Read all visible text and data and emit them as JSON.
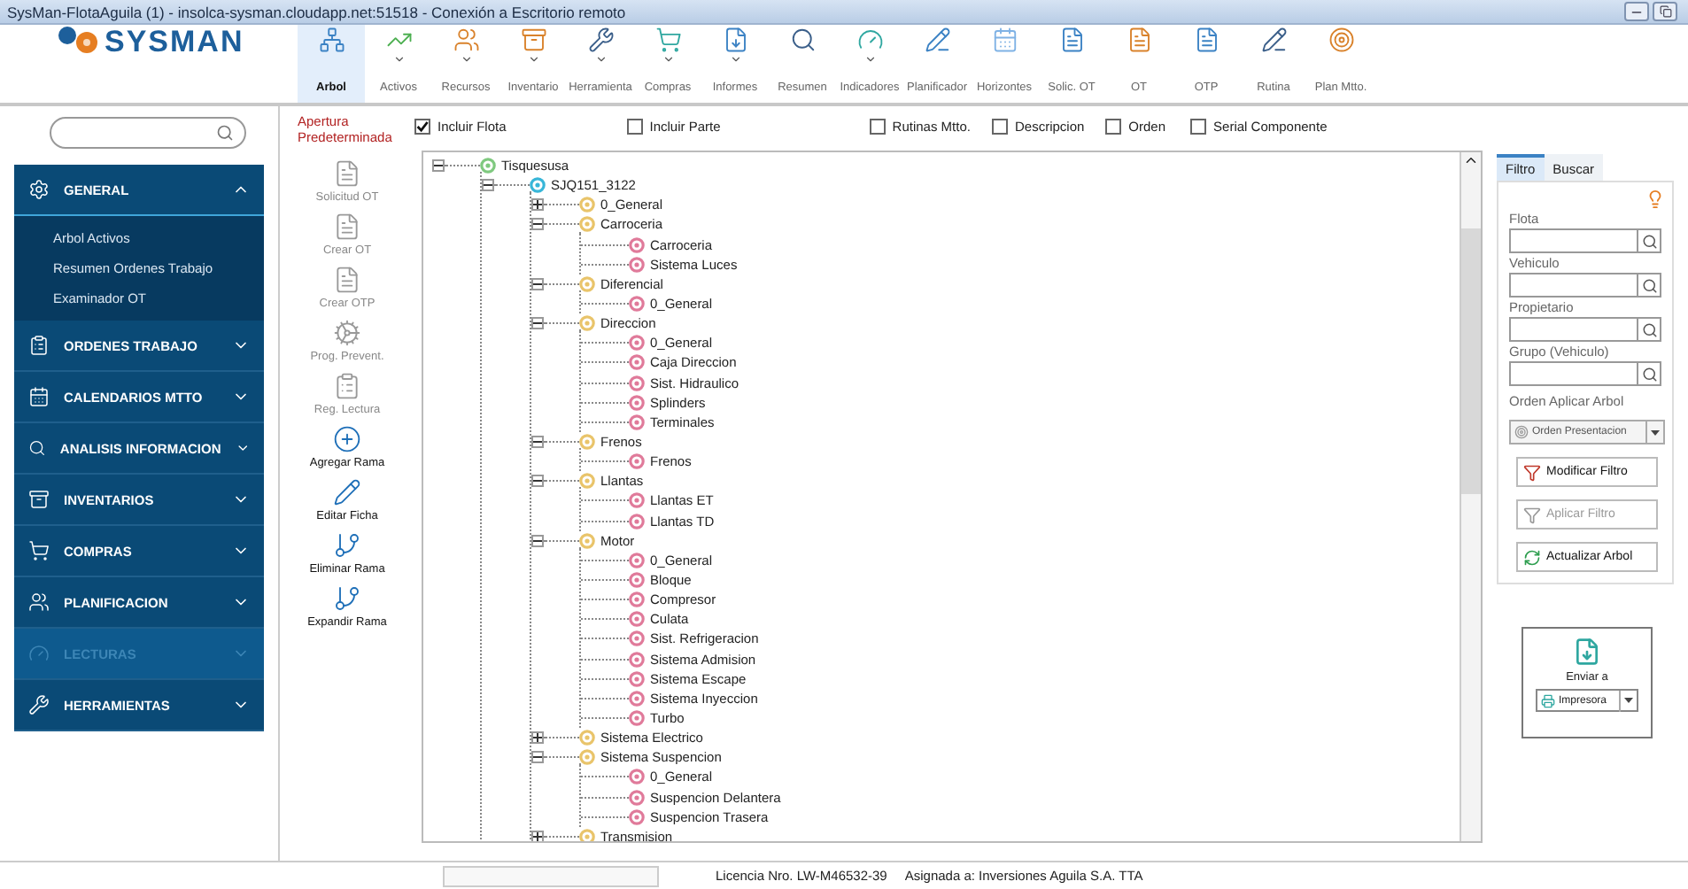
{
  "window": {
    "title": "SysMan-FlotaAguila (1) - insolca-sysman.cloudapp.net:51518 - Conexión a Escritorio remoto"
  },
  "logo": {
    "text": "SYSMAN"
  },
  "toolbar": {
    "items": [
      {
        "label": "Arbol",
        "selected": true,
        "has_menu": false
      },
      {
        "label": "Activos",
        "selected": false,
        "has_menu": true
      },
      {
        "label": "Recursos",
        "selected": false,
        "has_menu": true
      },
      {
        "label": "Inventario",
        "selected": false,
        "has_menu": true
      },
      {
        "label": "Herramienta",
        "selected": false,
        "has_menu": true
      },
      {
        "label": "Compras",
        "selected": false,
        "has_menu": true
      },
      {
        "label": "Informes",
        "selected": false,
        "has_menu": true
      },
      {
        "label": "Resumen",
        "selected": false,
        "has_menu": false
      },
      {
        "label": "Indicadores",
        "selected": false,
        "has_menu": true
      },
      {
        "label": "Planificador",
        "selected": false,
        "has_menu": false
      },
      {
        "label": "Horizontes",
        "selected": false,
        "has_menu": false
      },
      {
        "label": "Solic. OT",
        "selected": false,
        "has_menu": false
      },
      {
        "label": "OT",
        "selected": false,
        "has_menu": false
      },
      {
        "label": "OTP",
        "selected": false,
        "has_menu": false
      },
      {
        "label": "Rutina",
        "selected": false,
        "has_menu": false
      },
      {
        "label": "Plan Mtto.",
        "selected": false,
        "has_menu": false
      }
    ]
  },
  "sidebar": {
    "sections": [
      {
        "label": "GENERAL",
        "expanded": true,
        "disabled": false,
        "children": [
          "Arbol Activos",
          "Resumen Ordenes Trabajo",
          "Examinador OT"
        ]
      },
      {
        "label": "ORDENES TRABAJO",
        "expanded": false,
        "disabled": false
      },
      {
        "label": "CALENDARIOS MTTO",
        "expanded": false,
        "disabled": false
      },
      {
        "label": "ANALISIS INFORMACION",
        "expanded": false,
        "disabled": false
      },
      {
        "label": "INVENTARIOS",
        "expanded": false,
        "disabled": false
      },
      {
        "label": "COMPRAS",
        "expanded": false,
        "disabled": false
      },
      {
        "label": "PLANIFICACION",
        "expanded": false,
        "disabled": false
      },
      {
        "label": "LECTURAS",
        "expanded": false,
        "disabled": true
      },
      {
        "label": "HERRAMIENTAS",
        "expanded": false,
        "disabled": false
      }
    ]
  },
  "actions": {
    "heading": "Apertura Predeterminada",
    "items": [
      {
        "label": "Solicitud OT",
        "disabled": true
      },
      {
        "label": "Crear OT",
        "disabled": true
      },
      {
        "label": "Crear OTP",
        "disabled": true
      },
      {
        "label": "Prog. Prevent.",
        "disabled": true
      },
      {
        "label": "Reg. Lectura",
        "disabled": true
      },
      {
        "label": "Agregar Rama",
        "disabled": false
      },
      {
        "label": "Editar Ficha",
        "disabled": false
      },
      {
        "label": "Eliminar Rama",
        "disabled": false
      },
      {
        "label": "Expandir Rama",
        "disabled": false
      }
    ]
  },
  "filters": [
    {
      "label": "Incluir Flota",
      "checked": true
    },
    {
      "label": "Incluir Parte",
      "checked": false
    },
    {
      "label": "Rutinas Mtto.",
      "checked": false
    },
    {
      "label": "Descripcion",
      "checked": false
    },
    {
      "label": "Orden",
      "checked": false
    },
    {
      "label": "Serial Componente",
      "checked": false
    }
  ],
  "tree": [
    {
      "label": "Tisquesusa",
      "kind": "fleet",
      "expanded": true,
      "children": [
        {
          "label": "SJQ151_3122",
          "kind": "vehicle",
          "expanded": true,
          "children": [
            {
              "label": "0_General",
              "kind": "system",
              "expanded": false
            },
            {
              "label": "Carroceria",
              "kind": "system",
              "expanded": true,
              "children": [
                {
                  "label": "Carroceria",
                  "kind": "part"
                },
                {
                  "label": "Sistema Luces",
                  "kind": "part"
                }
              ]
            },
            {
              "label": "Diferencial",
              "kind": "system",
              "expanded": true,
              "children": [
                {
                  "label": "0_General",
                  "kind": "part"
                }
              ]
            },
            {
              "label": "Direccion",
              "kind": "system",
              "expanded": true,
              "children": [
                {
                  "label": "0_General",
                  "kind": "part"
                },
                {
                  "label": "Caja Direccion",
                  "kind": "part"
                },
                {
                  "label": "Sist. Hidraulico",
                  "kind": "part"
                },
                {
                  "label": "Splinders",
                  "kind": "part"
                },
                {
                  "label": "Terminales",
                  "kind": "part"
                }
              ]
            },
            {
              "label": "Frenos",
              "kind": "system",
              "expanded": true,
              "children": [
                {
                  "label": "Frenos",
                  "kind": "part"
                }
              ]
            },
            {
              "label": "Llantas",
              "kind": "system",
              "expanded": true,
              "children": [
                {
                  "label": "Llantas ET",
                  "kind": "part"
                },
                {
                  "label": "Llantas TD",
                  "kind": "part"
                }
              ]
            },
            {
              "label": "Motor",
              "kind": "system",
              "expanded": true,
              "children": [
                {
                  "label": "0_General",
                  "kind": "part"
                },
                {
                  "label": "Bloque",
                  "kind": "part"
                },
                {
                  "label": "Compresor",
                  "kind": "part"
                },
                {
                  "label": "Culata",
                  "kind": "part"
                },
                {
                  "label": "Sist. Refrigeracion",
                  "kind": "part"
                },
                {
                  "label": "Sistema Admision",
                  "kind": "part"
                },
                {
                  "label": "Sistema Escape",
                  "kind": "part"
                },
                {
                  "label": "Sistema Inyeccion",
                  "kind": "part"
                },
                {
                  "label": "Turbo",
                  "kind": "part"
                }
              ]
            },
            {
              "label": "Sistema Electrico",
              "kind": "system",
              "expanded": false
            },
            {
              "label": "Sistema Suspencion",
              "kind": "system",
              "expanded": true,
              "children": [
                {
                  "label": "0_General",
                  "kind": "part"
                },
                {
                  "label": "Suspencion Delantera",
                  "kind": "part"
                },
                {
                  "label": "Suspencion Trasera",
                  "kind": "part"
                }
              ]
            },
            {
              "label": "Transmision",
              "kind": "system",
              "expanded": false
            }
          ]
        }
      ]
    }
  ],
  "filter_panel": {
    "tabs": [
      {
        "label": "Filtro",
        "selected": true
      },
      {
        "label": "Buscar",
        "selected": false
      }
    ],
    "fields": [
      {
        "label": "Flota"
      },
      {
        "label": "Vehiculo"
      },
      {
        "label": "Propietario"
      },
      {
        "label": "Grupo (Vehiculo)"
      }
    ],
    "order_label": "Orden Aplicar Arbol",
    "order_value": "Orden Presentacion",
    "buttons": [
      {
        "label": "Modificar Filtro",
        "disabled": false
      },
      {
        "label": "Aplicar Filtro",
        "disabled": true
      },
      {
        "label": "Actualizar Arbol",
        "disabled": false
      }
    ]
  },
  "send": {
    "label": "Enviar a",
    "target": "Impresora"
  },
  "status_bar": {
    "license": "Licencia Nro. LW-M46532-39",
    "assigned": "Asignada a: Inversiones Aguila S.A. TTA"
  }
}
